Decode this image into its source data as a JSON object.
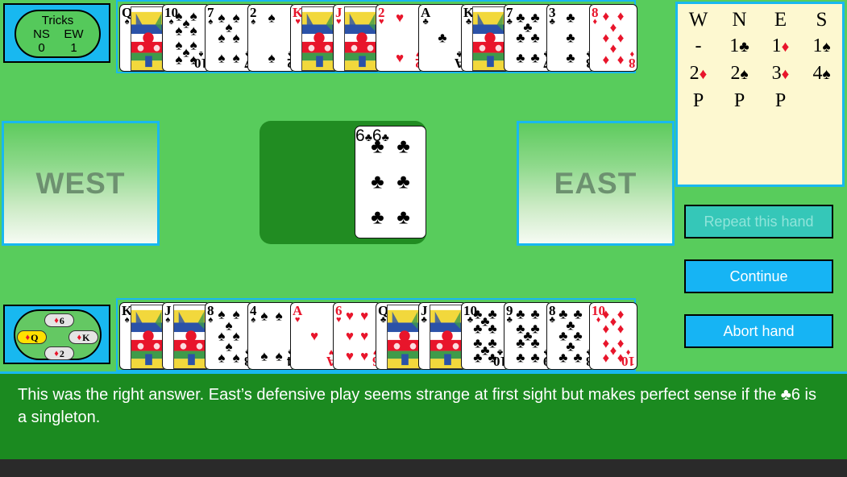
{
  "tricks": {
    "title": "Tricks",
    "ns_label": "NS",
    "ew_label": "EW",
    "ns_value": "0",
    "ew_value": "1"
  },
  "seats": {
    "west_label": "WEST",
    "east_label": "EAST"
  },
  "north_hand": [
    {
      "rank": "Q",
      "suit": "♠",
      "color": "blk",
      "face": true
    },
    {
      "rank": "10",
      "suit": "♠",
      "color": "blk",
      "face": false,
      "count": 10
    },
    {
      "rank": "7",
      "suit": "♠",
      "color": "blk",
      "face": false,
      "count": 7
    },
    {
      "rank": "2",
      "suit": "♠",
      "color": "blk",
      "face": false,
      "count": 2
    },
    {
      "rank": "K",
      "suit": "♥",
      "color": "red",
      "face": true
    },
    {
      "rank": "J",
      "suit": "♥",
      "color": "red",
      "face": true
    },
    {
      "rank": "2",
      "suit": "♥",
      "color": "red",
      "face": false,
      "count": 2
    },
    {
      "rank": "A",
      "suit": "♣",
      "color": "blk",
      "face": false,
      "count": 1
    },
    {
      "rank": "K",
      "suit": "♣",
      "color": "blk",
      "face": true
    },
    {
      "rank": "7",
      "suit": "♣",
      "color": "blk",
      "face": false,
      "count": 7
    },
    {
      "rank": "3",
      "suit": "♣",
      "color": "blk",
      "face": false,
      "count": 3
    },
    {
      "rank": "8",
      "suit": "♦",
      "color": "red",
      "face": false,
      "count": 8
    }
  ],
  "south_hand": [
    {
      "rank": "K",
      "suit": "♠",
      "color": "blk",
      "face": true
    },
    {
      "rank": "J",
      "suit": "♠",
      "color": "blk",
      "face": true
    },
    {
      "rank": "8",
      "suit": "♠",
      "color": "blk",
      "face": false,
      "count": 8
    },
    {
      "rank": "4",
      "suit": "♠",
      "color": "blk",
      "face": false,
      "count": 4
    },
    {
      "rank": "A",
      "suit": "♥",
      "color": "red",
      "face": false,
      "count": 1
    },
    {
      "rank": "6",
      "suit": "♥",
      "color": "red",
      "face": false,
      "count": 6
    },
    {
      "rank": "Q",
      "suit": "♣",
      "color": "blk",
      "face": true
    },
    {
      "rank": "J",
      "suit": "♣",
      "color": "blk",
      "face": true
    },
    {
      "rank": "10",
      "suit": "♣",
      "color": "blk",
      "face": false,
      "count": 10
    },
    {
      "rank": "9",
      "suit": "♣",
      "color": "blk",
      "face": false,
      "count": 9
    },
    {
      "rank": "8",
      "suit": "♣",
      "color": "blk",
      "face": false,
      "count": 8
    },
    {
      "rank": "10",
      "suit": "♦",
      "color": "red",
      "face": false,
      "count": 10
    }
  ],
  "played_card": {
    "rank": "6",
    "suit": "♣",
    "color": "blk",
    "count": 6
  },
  "last_trick": {
    "north": {
      "rank": "6",
      "suit": "♦",
      "color": "red",
      "winner": false
    },
    "west": {
      "rank": "Q",
      "suit": "♦",
      "color": "red",
      "winner": true
    },
    "east": {
      "rank": "K",
      "suit": "♦",
      "color": "red",
      "winner": false
    },
    "south": {
      "rank": "2",
      "suit": "♦",
      "color": "red",
      "winner": false
    }
  },
  "bidding": {
    "headers": [
      "W",
      "N",
      "E",
      "S"
    ],
    "rows": [
      [
        {
          "level": "-",
          "suit": "",
          "color": ""
        },
        {
          "level": "1",
          "suit": "♣",
          "color": "blk"
        },
        {
          "level": "1",
          "suit": "♦",
          "color": "red"
        },
        {
          "level": "1",
          "suit": "♠",
          "color": "blk"
        }
      ],
      [
        {
          "level": "2",
          "suit": "♦",
          "color": "red"
        },
        {
          "level": "2",
          "suit": "♠",
          "color": "blk"
        },
        {
          "level": "3",
          "suit": "♦",
          "color": "red"
        },
        {
          "level": "4",
          "suit": "♠",
          "color": "blk"
        }
      ],
      [
        {
          "level": "P",
          "suit": "",
          "color": ""
        },
        {
          "level": "P",
          "suit": "",
          "color": ""
        },
        {
          "level": "P",
          "suit": "",
          "color": ""
        },
        {
          "level": "",
          "suit": "",
          "color": ""
        }
      ]
    ]
  },
  "buttons": {
    "repeat": "Repeat this hand",
    "continue": "Continue",
    "abort": "Abort hand"
  },
  "message": "This was the right answer. East’s defensive play seems strange at first sight but makes perfect sense if the ♣6 is a singleton.",
  "colors": {
    "background_green": "#58cc5c",
    "table_green": "#218c22",
    "cyan_border": "#18b8f0",
    "bid_panel_cream": "#fdf8d0",
    "button_blue": "#16b4f4",
    "button_disabled": "#35c7b8",
    "message_green": "#1b8a20",
    "red_suit": "#e8152b",
    "highlight_yellow": "#ffe000"
  }
}
